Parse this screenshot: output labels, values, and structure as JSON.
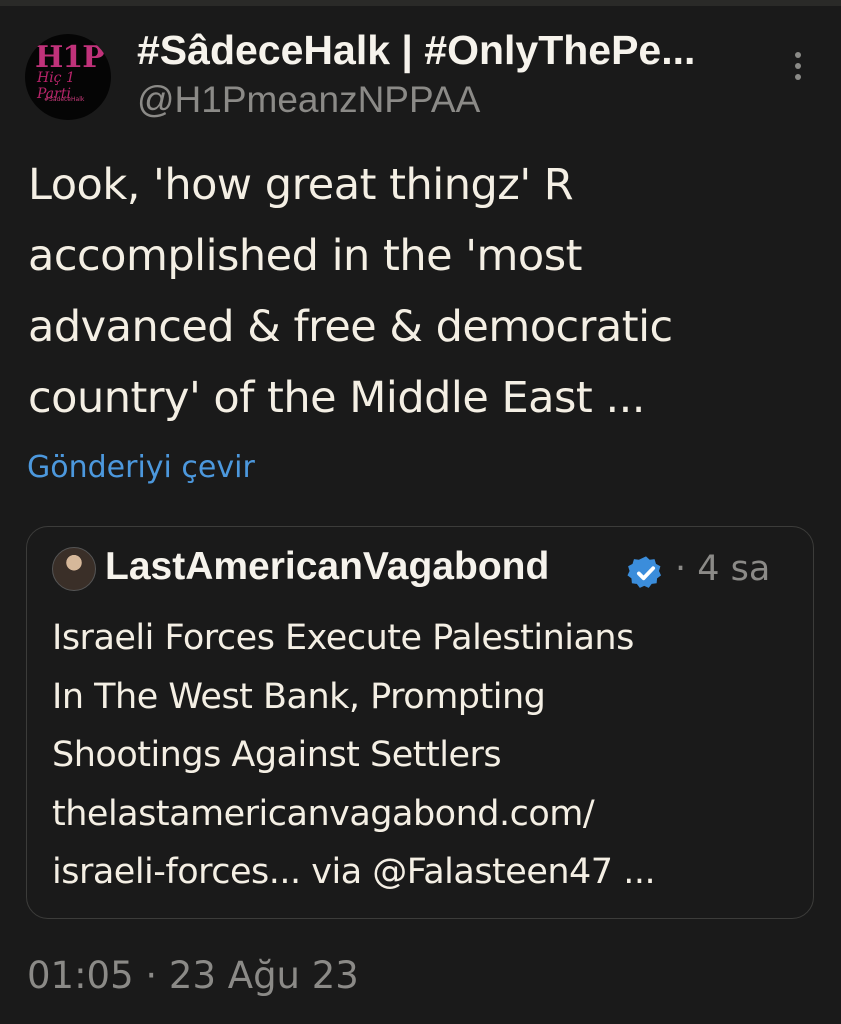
{
  "author": {
    "display_name": "#SâdeceHalk | #OnlyThePe...",
    "handle": "@H1PmeanzNPPAA",
    "avatar": {
      "logo_text": "H1P",
      "sub_text": "Hiç 1 Parti",
      "tag_text": "#SâdeceHalk"
    }
  },
  "more_icon": "more-vertical-icon",
  "tweet": {
    "text": "Look, 'how great thingz' R\naccomplished in the 'most\nadvanced & free & democratic\ncountry' of the Middle East ...",
    "translate_label": "Gönderiyi çevir",
    "timestamp": "01:05 · 23 Ağu 23"
  },
  "quoted_tweet": {
    "author_name": "LastAmericanVagabond",
    "verified_icon": "verified-badge-icon",
    "time": "· 4 sa",
    "text": "Israeli Forces Execute Palestinians\nIn The West Bank, Prompting\nShootings Against Settlers\nthelastamericanvagabond.com/\nisraeli-forces... via @Falasteen47 ..."
  },
  "colors": {
    "background": "#1a1a1a",
    "link": "#4c98dd",
    "muted": "#8b8a87",
    "verified": "#3b8ddb"
  }
}
